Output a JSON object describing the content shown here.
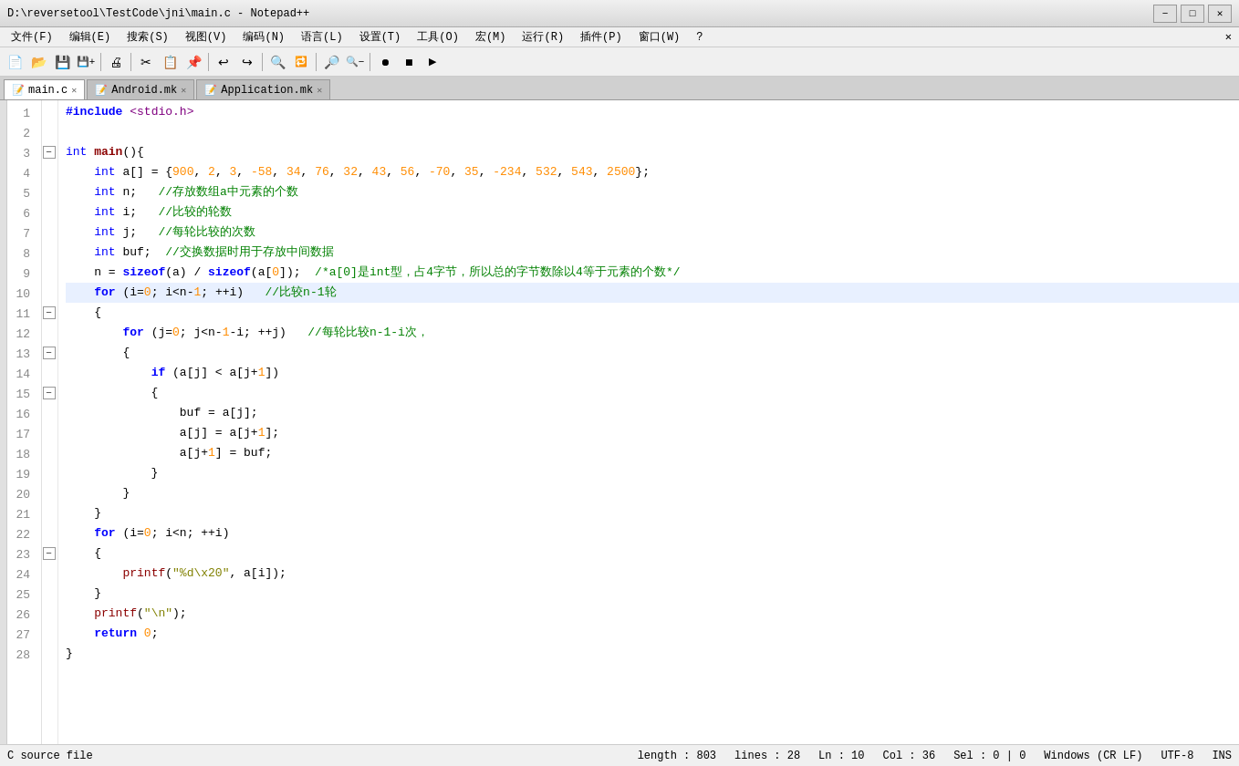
{
  "titlebar": {
    "title": "D:\\reversetool\\TestCode\\jni\\main.c - Notepad++",
    "minimize": "−",
    "maximize": "□",
    "close": "✕",
    "extra_close": "✕"
  },
  "menubar": {
    "items": [
      "文件(F)",
      "编辑(E)",
      "搜索(S)",
      "视图(V)",
      "编码(N)",
      "语言(L)",
      "设置(T)",
      "工具(O)",
      "宏(M)",
      "运行(R)",
      "插件(P)",
      "窗口(W)",
      "?"
    ]
  },
  "tabs": [
    {
      "label": "main.c",
      "active": true
    },
    {
      "label": "Android.mk",
      "active": false
    },
    {
      "label": "Application.mk",
      "active": false
    }
  ],
  "statusbar": {
    "file_type": "C source file",
    "length": "length : 803",
    "lines": "lines : 28",
    "ln": "Ln : 10",
    "col": "Col : 36",
    "sel": "Sel : 0 | 0",
    "encoding": "Windows (CR LF)",
    "charset": "UTF-8",
    "ins": "INS"
  },
  "code": {
    "lines": [
      {
        "num": 1,
        "content": "#include <stdio.h>",
        "type": "preproc"
      },
      {
        "num": 2,
        "content": "",
        "type": "plain"
      },
      {
        "num": 3,
        "content": "int main(){",
        "type": "mixed",
        "fold": true
      },
      {
        "num": 4,
        "content": "    int a[] = {900, 2, 3, -58, 34, 76, 32, 43, 56, -70, 35, -234, 532, 543, 2500};",
        "type": "code"
      },
      {
        "num": 5,
        "content": "    int n;   //存放数组a中元素的个数",
        "type": "code"
      },
      {
        "num": 6,
        "content": "    int i;   //比较的轮数",
        "type": "code"
      },
      {
        "num": 7,
        "content": "    int j;   //每轮比较的次数",
        "type": "code"
      },
      {
        "num": 8,
        "content": "    int buf;  //交换数据时用于存放中间数据",
        "type": "code"
      },
      {
        "num": 9,
        "content": "    n = sizeof(a) / sizeof(a[0]);  /*a[0]是int型，占4字节，所以总的字节数除以4等于元素的个数*/",
        "type": "code"
      },
      {
        "num": 10,
        "content": "    for (i=0; i<n-1; ++i)   //比较n-1轮",
        "type": "code",
        "highlighted": true
      },
      {
        "num": 11,
        "content": "    {",
        "type": "brace",
        "fold": true
      },
      {
        "num": 12,
        "content": "        for (j=0; j<n-1-i; ++j)   //每轮比较n-1-i次，",
        "type": "code"
      },
      {
        "num": 13,
        "content": "        {",
        "type": "brace",
        "fold": true
      },
      {
        "num": 14,
        "content": "            if (a[j] < a[j+1])",
        "type": "code"
      },
      {
        "num": 15,
        "content": "            {",
        "type": "brace",
        "fold": true
      },
      {
        "num": 16,
        "content": "                buf = a[j];",
        "type": "code"
      },
      {
        "num": 17,
        "content": "                a[j] = a[j+1];",
        "type": "code"
      },
      {
        "num": 18,
        "content": "                a[j+1] = buf;",
        "type": "code"
      },
      {
        "num": 19,
        "content": "            }",
        "type": "brace"
      },
      {
        "num": 20,
        "content": "        }",
        "type": "brace"
      },
      {
        "num": 21,
        "content": "        }",
        "type": "brace"
      },
      {
        "num": 22,
        "content": "    for (i=0; i<n; ++i)",
        "type": "code"
      },
      {
        "num": 23,
        "content": "    {",
        "type": "brace",
        "fold": true
      },
      {
        "num": 24,
        "content": "        printf(\"%d\\x20\", a[i]);",
        "type": "code"
      },
      {
        "num": 25,
        "content": "    }",
        "type": "brace"
      },
      {
        "num": 26,
        "content": "    printf(\"\\n\");",
        "type": "code"
      },
      {
        "num": 27,
        "content": "    return 0;",
        "type": "code"
      },
      {
        "num": 28,
        "content": "}",
        "type": "brace"
      }
    ]
  }
}
